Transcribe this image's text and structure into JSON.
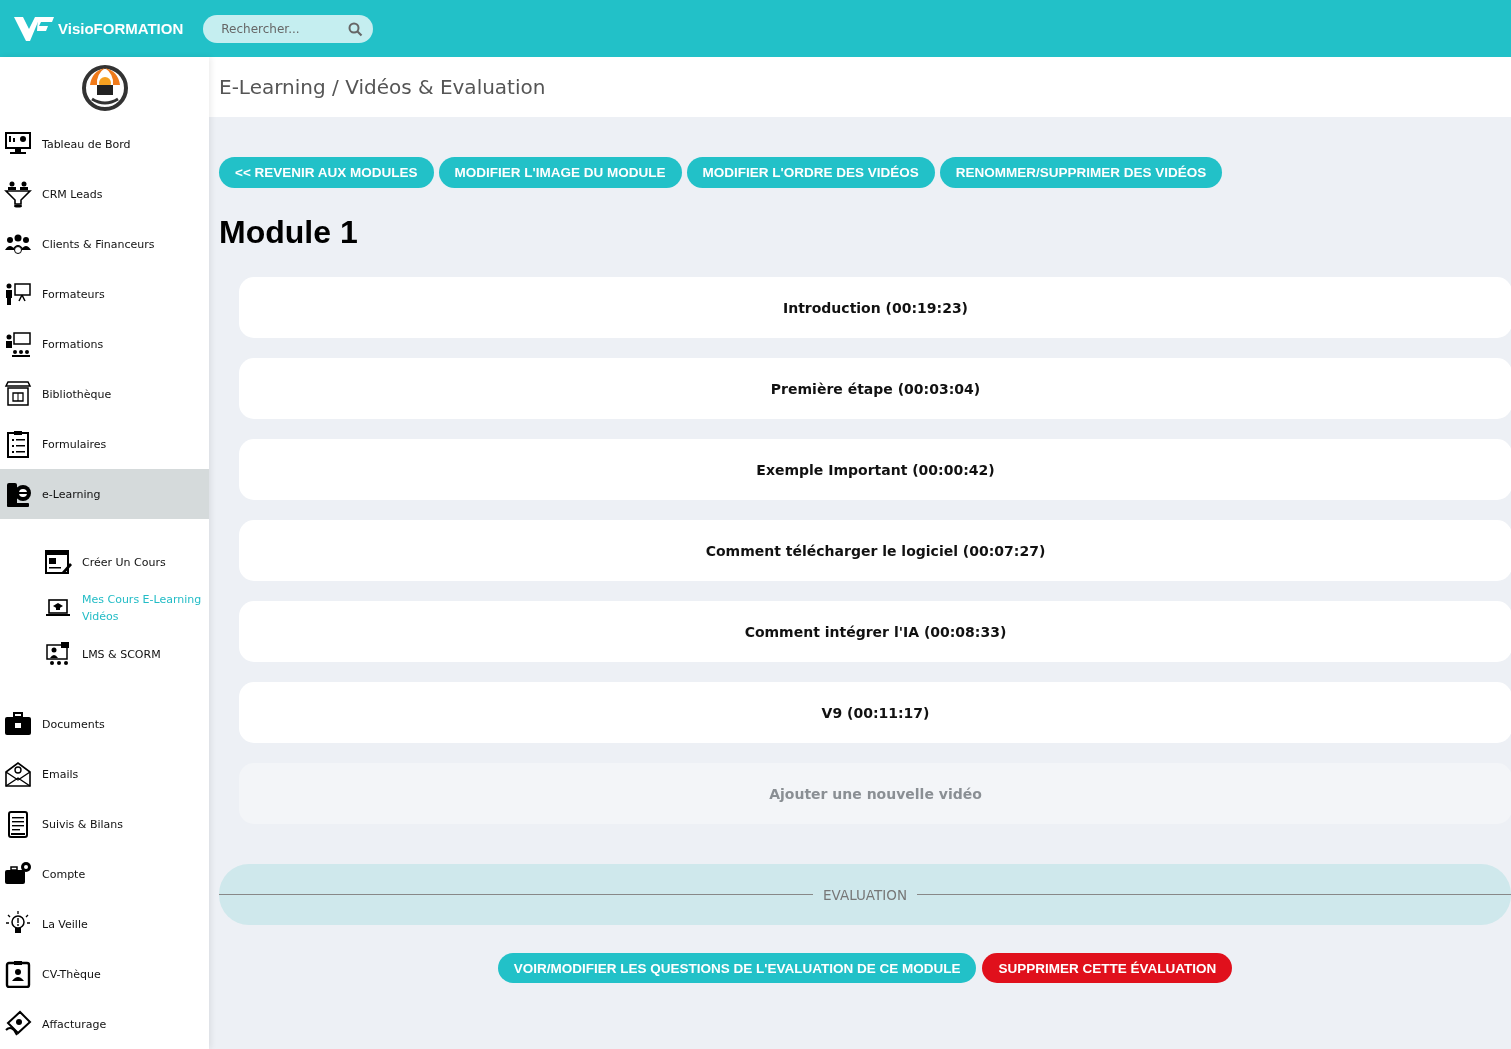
{
  "header": {
    "brand": "VisioFORMATION",
    "search": {
      "placeholder": "Rechercher..."
    }
  },
  "sidebar": {
    "items": [
      {
        "label": "Tableau de Bord",
        "selected": false
      },
      {
        "label": "CRM Leads",
        "selected": false
      },
      {
        "label": "Clients & Financeurs",
        "selected": false
      },
      {
        "label": "Formateurs",
        "selected": false
      },
      {
        "label": "Formations",
        "selected": false
      },
      {
        "label": "Bibliothèque",
        "selected": false
      },
      {
        "label": "Formulaires",
        "selected": false
      },
      {
        "label": "e-Learning",
        "selected": true,
        "expanded": true,
        "children": [
          {
            "label": "Créer Un Cours",
            "selected": false
          },
          {
            "label": "Mes Cours E-Learning Vidéos",
            "selected": true
          },
          {
            "label": "LMS & SCORM",
            "selected": false
          }
        ]
      },
      {
        "label": "Documents",
        "selected": false
      },
      {
        "label": "Emails",
        "selected": false
      },
      {
        "label": "Suivis & Bilans",
        "selected": false
      },
      {
        "label": "Compte",
        "selected": false
      },
      {
        "label": "La Veille",
        "selected": false
      },
      {
        "label": "CV-Thèque",
        "selected": false
      },
      {
        "label": "Affacturage",
        "selected": false
      }
    ]
  },
  "breadcrumb": "E-Learning / Vidéos & Evaluation",
  "actions": [
    "<< REVENIR AUX MODULES",
    "MODIFIER L'IMAGE DU MODULE",
    "MODIFIER L'ORDRE DES VIDÉOS",
    "RENOMMER/SUPPRIMER DES VIDÉOS"
  ],
  "module_title": "Module 1",
  "videos": [
    {
      "label": "Introduction (00:19:23)"
    },
    {
      "label": "Première étape (00:03:04)"
    },
    {
      "label": "Exemple Important (00:00:42)"
    },
    {
      "label": "Comment télécharger le logiciel (00:07:27)"
    },
    {
      "label": "Comment intégrer l'IA (00:08:33)"
    },
    {
      "label": "V9 (00:11:17)"
    }
  ],
  "add_video": {
    "label": "Ajouter une nouvelle vidéo"
  },
  "evaluation": {
    "heading": "EVALUATION",
    "actions": [
      {
        "label": "VOIR/MODIFIER LES QUESTIONS DE L'EVALUATION DE CE MODULE",
        "kind": "primary"
      },
      {
        "label": "SUPPRIMER CETTE ÉVALUATION",
        "kind": "danger"
      }
    ]
  }
}
